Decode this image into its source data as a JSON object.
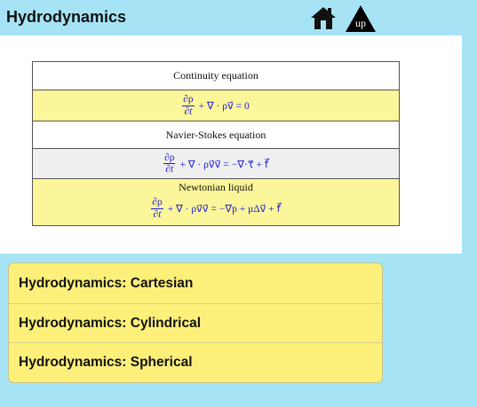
{
  "header": {
    "title": "Hydrodynamics",
    "home_icon": "home-icon",
    "up_label": "up"
  },
  "equations": {
    "continuity_label": "Continuity equation",
    "continuity_formula": {
      "num": "∂ρ",
      "den": "∂t",
      "rest": "+ ∇ · ρv⃗ = 0"
    },
    "navier_label": "Navier-Stokes equation",
    "navier_formula": {
      "num": "∂ρ",
      "den": "∂t",
      "rest": "+ ∇ · ρv⃗v⃗ = −∇·τ⃗ + f⃗"
    },
    "newtonian_label": "Newtonian liquid",
    "newtonian_formula": {
      "num": "∂ρ",
      "den": "∂t",
      "rest": "+ ∇ · ρv⃗v⃗ = −∇p + μΔv⃗ + f⃗"
    }
  },
  "menu": {
    "items": [
      "Hydrodynamics: Cartesian",
      "Hydrodynamics: Cylindrical",
      "Hydrodynamics: Spherical"
    ]
  },
  "colors": {
    "background": "#a6e4f5",
    "formula_blue": "#1a1ad4",
    "row_yellow": "#fcf69a",
    "menu_yellow": "#fdf07a"
  }
}
